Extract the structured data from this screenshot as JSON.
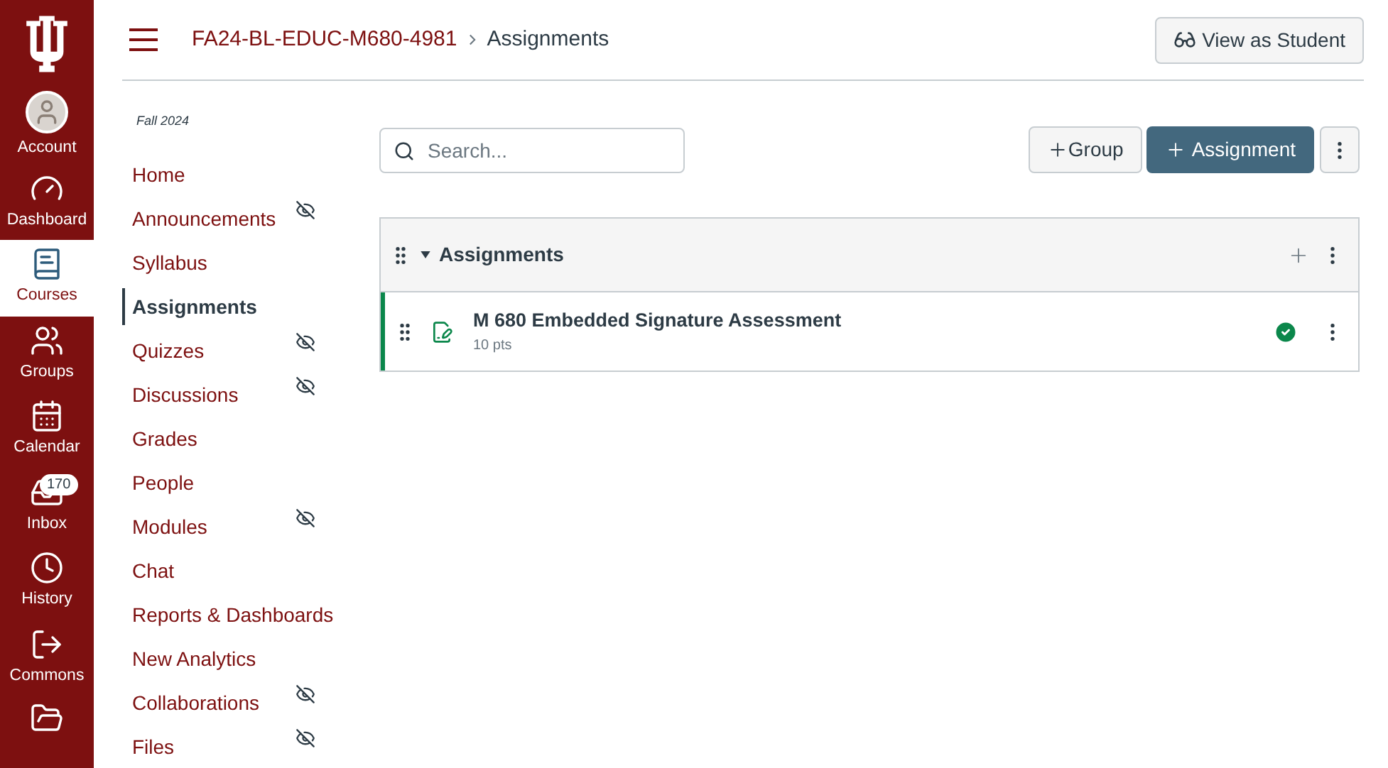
{
  "global_nav": [
    {
      "label": "Account",
      "selected": false
    },
    {
      "label": "Dashboard",
      "selected": false
    },
    {
      "label": "Courses",
      "selected": true
    },
    {
      "label": "Groups",
      "selected": false
    },
    {
      "label": "Calendar",
      "selected": false
    },
    {
      "label": "Inbox",
      "selected": false,
      "badge": "170"
    },
    {
      "label": "History",
      "selected": false
    },
    {
      "label": "Commons",
      "selected": false
    }
  ],
  "breadcrumb": [
    "FA24-BL-EDUC-M680-4981",
    "Assignments"
  ],
  "view_as_student": "View as Student",
  "course_nav": {
    "term": "Fall 2024",
    "items": [
      {
        "label": "Home",
        "selected": false,
        "hidden": false
      },
      {
        "label": "Announcements",
        "selected": false,
        "hidden": true
      },
      {
        "label": "Syllabus",
        "selected": false,
        "hidden": false
      },
      {
        "label": "Assignments",
        "selected": true,
        "hidden": false
      },
      {
        "label": "Quizzes",
        "selected": false,
        "hidden": true
      },
      {
        "label": "Discussions",
        "selected": false,
        "hidden": true
      },
      {
        "label": "Grades",
        "selected": false,
        "hidden": false
      },
      {
        "label": "People",
        "selected": false,
        "hidden": false
      },
      {
        "label": "Modules",
        "selected": false,
        "hidden": true
      },
      {
        "label": "Chat",
        "selected": false,
        "hidden": false
      },
      {
        "label": "Reports & Dashboards",
        "selected": false,
        "hidden": false
      },
      {
        "label": "New Analytics",
        "selected": false,
        "hidden": false
      },
      {
        "label": "Collaborations",
        "selected": false,
        "hidden": true
      },
      {
        "label": "Files",
        "selected": false,
        "hidden": true
      }
    ]
  },
  "search": {
    "placeholder": "Search..."
  },
  "buttons": {
    "group": "Group",
    "assignment": "Assignment"
  },
  "group": {
    "title": "Assignments",
    "expanded": true,
    "assignments": [
      {
        "title": "M 680 Embedded Signature Assessment",
        "points": "10 pts",
        "published": true
      }
    ]
  }
}
